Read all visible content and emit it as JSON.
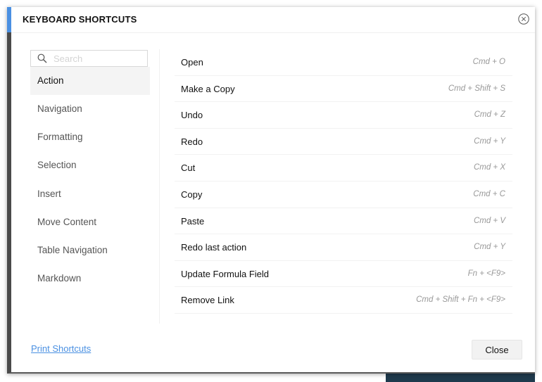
{
  "dialog": {
    "title": "KEYBOARD SHORTCUTS",
    "accent_color": "#4a90e2"
  },
  "search": {
    "placeholder": "Search",
    "value": ""
  },
  "categories": [
    {
      "label": "Action",
      "active": true
    },
    {
      "label": "Navigation",
      "active": false
    },
    {
      "label": "Formatting",
      "active": false
    },
    {
      "label": "Selection",
      "active": false
    },
    {
      "label": "Insert",
      "active": false
    },
    {
      "label": "Move Content",
      "active": false
    },
    {
      "label": "Table Navigation",
      "active": false
    },
    {
      "label": "Markdown",
      "active": false
    }
  ],
  "shortcuts": [
    {
      "name": "Open",
      "keys": "Cmd + O"
    },
    {
      "name": "Make a Copy",
      "keys": "Cmd + Shift + S"
    },
    {
      "name": "Undo",
      "keys": "Cmd + Z"
    },
    {
      "name": "Redo",
      "keys": "Cmd + Y"
    },
    {
      "name": "Cut",
      "keys": "Cmd + X"
    },
    {
      "name": "Copy",
      "keys": "Cmd + C"
    },
    {
      "name": "Paste",
      "keys": "Cmd + V"
    },
    {
      "name": "Redo last action",
      "keys": "Cmd + Y"
    },
    {
      "name": "Update Formula Field",
      "keys": "Fn + <F9>"
    },
    {
      "name": "Remove Link",
      "keys": "Cmd + Shift + Fn + <F9>"
    }
  ],
  "footer": {
    "print_label": "Print Shortcuts",
    "close_label": "Close"
  },
  "icons": {
    "close": "close-circle-icon",
    "search": "search-icon"
  }
}
